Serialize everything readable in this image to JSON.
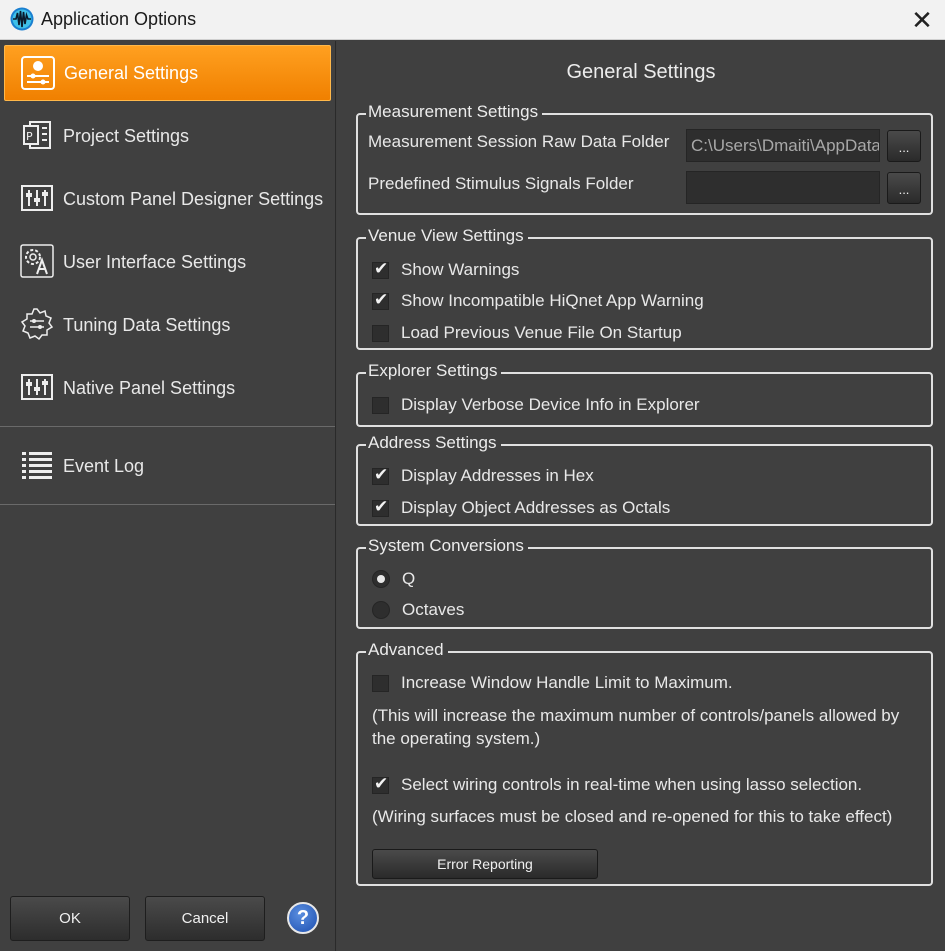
{
  "window": {
    "title": "Application Options",
    "app_icon": "waveform-icon",
    "close_label": "✕"
  },
  "sidebar": {
    "items": [
      {
        "label": "General Settings",
        "icon": "general-settings-icon",
        "active": true
      },
      {
        "label": "Project Settings",
        "icon": "project-settings-icon"
      },
      {
        "label": "Custom Panel Designer Settings",
        "icon": "panel-designer-icon"
      },
      {
        "label": "User Interface Settings",
        "icon": "user-interface-icon"
      },
      {
        "label": "Tuning Data Settings",
        "icon": "tuning-data-icon"
      },
      {
        "label": "Native Panel Settings",
        "icon": "native-panel-icon"
      },
      {
        "label": "Event Log",
        "icon": "event-log-icon"
      }
    ],
    "ok_label": "OK",
    "cancel_label": "Cancel",
    "help_label": "?"
  },
  "main": {
    "title": "General Settings",
    "measurement": {
      "title": "Measurement Settings",
      "raw_folder_label": "Measurement Session Raw Data Folder",
      "raw_folder_value": "C:\\Users\\Dmaiti\\AppData",
      "stimulus_folder_label": "Predefined Stimulus Signals Folder",
      "stimulus_folder_value": "",
      "browse_label": "..."
    },
    "venue": {
      "title": "Venue View Settings",
      "items": [
        {
          "label": "Show Warnings",
          "checked": true
        },
        {
          "label": "Show Incompatible HiQnet App Warning",
          "checked": true
        },
        {
          "label": "Load Previous Venue File On Startup",
          "checked": false
        }
      ]
    },
    "explorer": {
      "title": "Explorer Settings",
      "items": [
        {
          "label": "Display Verbose Device Info in Explorer",
          "checked": false
        }
      ]
    },
    "address": {
      "title": "Address Settings",
      "items": [
        {
          "label": "Display Addresses in Hex",
          "checked": true
        },
        {
          "label": "Display Object Addresses as Octals",
          "checked": true
        }
      ]
    },
    "conversions": {
      "title": "System Conversions",
      "options": [
        {
          "label": "Q",
          "selected": true
        },
        {
          "label": "Octaves",
          "selected": false
        }
      ]
    },
    "advanced": {
      "title": "Advanced",
      "handle_limit_label": "Increase Window Handle Limit to Maximum.",
      "handle_limit_checked": false,
      "handle_limit_note": "(This will increase the maximum number of controls/panels allowed by the operating system.)",
      "lasso_label": "Select wiring controls in real-time when using lasso selection.",
      "lasso_checked": true,
      "lasso_note": "(Wiring surfaces must be closed and re-opened for this to take effect)",
      "error_reporting_label": "Error Reporting"
    }
  }
}
